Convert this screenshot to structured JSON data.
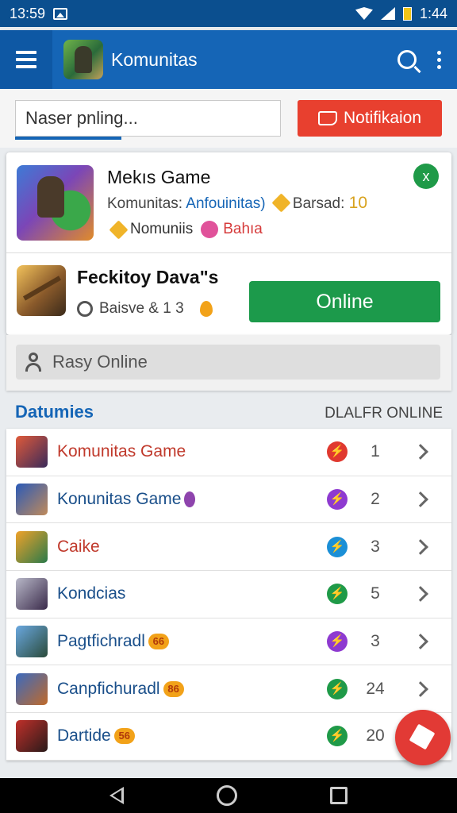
{
  "status_bar": {
    "time_left": "13:59",
    "time_right": "1:44"
  },
  "app_bar": {
    "title": "Komunitas"
  },
  "search": {
    "value": "Naser pnling...",
    "placeholder": "Naser pnling..."
  },
  "notification_button": {
    "label": "Notifikaion"
  },
  "featured": {
    "title": "Mekıs Game",
    "line1_prefix": "Komunitas:",
    "line1_link": "Anfouinitas)",
    "line1_label": "Barsad:",
    "line1_value": "10",
    "line2_a": "Nomuniis",
    "line2_b": "Bahıa",
    "check_icon": "x"
  },
  "second_game": {
    "title": "Feckitoy Dava\"s",
    "meta": "Baisve & 1 3",
    "online_button": "Online"
  },
  "easy_bar": {
    "label": "Rasy Online"
  },
  "section": {
    "title": "Datumies",
    "right_label": "DLALFR ONLINE"
  },
  "list_items": [
    {
      "label": "Komunitas Game",
      "badge": "",
      "count": "1",
      "label_color": "#c0392b",
      "dot_color": "#e0392f",
      "thumb": "linear-gradient(135deg,#e05a3a,#3a2a5a)"
    },
    {
      "label": "Konunitas Game",
      "badge": "purple",
      "count": "2",
      "label_color": "#1a4f8a",
      "dot_color": "#8e3ad0",
      "thumb": "linear-gradient(135deg,#2a5ab8,#c08a5a)"
    },
    {
      "label": "Caike",
      "badge": "",
      "count": "3",
      "label_color": "#c0392b",
      "dot_color": "#1b8fd6",
      "thumb": "linear-gradient(135deg,#f0a22a,#2a7a4a)"
    },
    {
      "label": "Kondcias",
      "badge": "",
      "count": "5",
      "label_color": "#1a4f8a",
      "dot_color": "#1f9a48",
      "thumb": "linear-gradient(135deg,#b8b8c8,#3a2a4a)"
    },
    {
      "label": "Pagtfichradl",
      "badge": "66",
      "count": "3",
      "label_color": "#1a4f8a",
      "dot_color": "#8e3ad0",
      "thumb": "linear-gradient(135deg,#6aa8e0,#2a4a3a)"
    },
    {
      "label": "Canpfichuradl",
      "badge": "86",
      "count": "24",
      "label_color": "#1a4f8a",
      "dot_color": "#1f9a48",
      "thumb": "linear-gradient(135deg,#3a6ac0,#c06a2a)"
    },
    {
      "label": "Dartide",
      "badge": "56",
      "count": "20",
      "label_color": "#1a4f8a",
      "dot_color": "#1f9a48",
      "thumb": "linear-gradient(135deg,#c0302a,#2a1a1a)"
    }
  ],
  "colors": {
    "primary": "#1565b6",
    "accent_red": "#e8402f",
    "online_green": "#1c9a4b"
  }
}
